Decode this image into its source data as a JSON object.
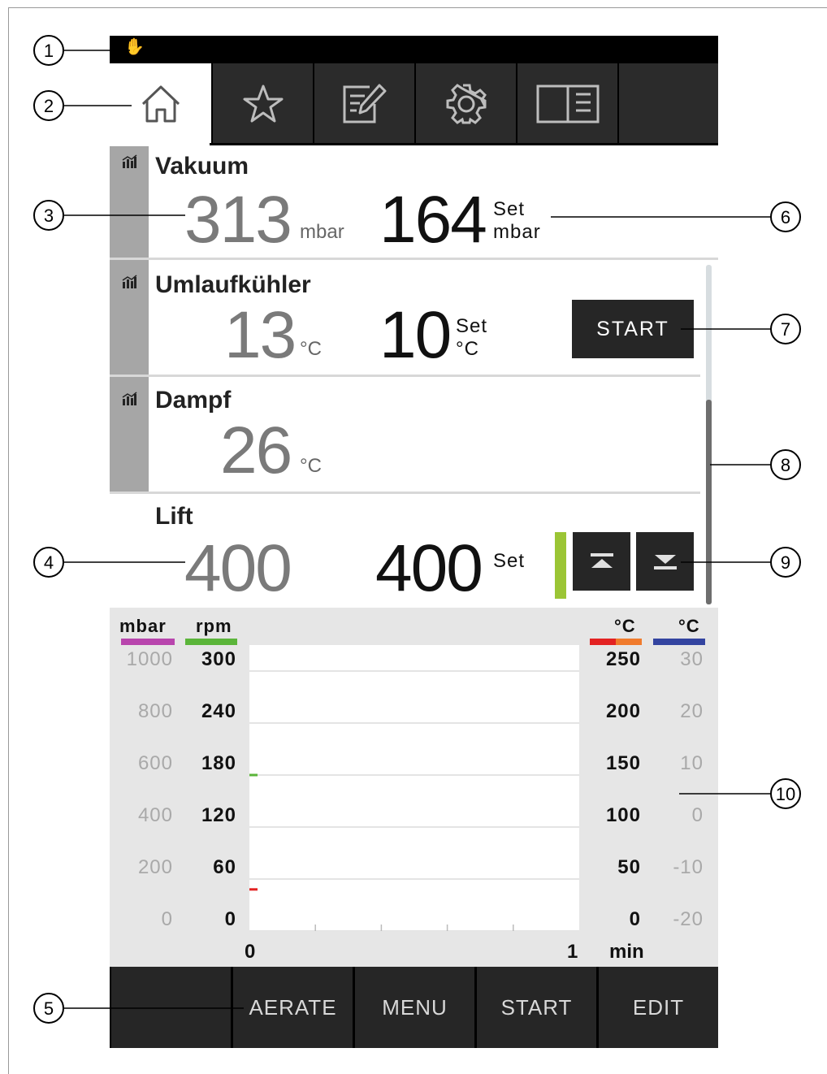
{
  "callouts": [
    "1",
    "2",
    "3",
    "4",
    "5",
    "6",
    "7",
    "8",
    "9",
    "10"
  ],
  "status_bar": {
    "hand_glyph": "✋"
  },
  "tabs": [
    {
      "icon": "home-icon",
      "active": true
    },
    {
      "icon": "star-icon",
      "active": false
    },
    {
      "icon": "edit-icon",
      "active": false
    },
    {
      "icon": "gear-icon",
      "active": false
    },
    {
      "icon": "book-icon",
      "active": false
    }
  ],
  "vakuum": {
    "title": "Vakuum",
    "actual": "313",
    "unit": "mbar",
    "set_value": "164",
    "set_label": "Set",
    "set_unit": "mbar"
  },
  "umlauf": {
    "title": "Umlaufkühler",
    "actual": "13",
    "unit": "°C",
    "set_value": "10",
    "set_label": "Set",
    "set_unit": "°C",
    "start_label": "START"
  },
  "dampf": {
    "title": "Dampf",
    "actual": "26",
    "unit": "°C"
  },
  "lift": {
    "title": "Lift",
    "actual": "400",
    "set_value": "400",
    "set_label": "Set",
    "indicator_color": "#9bc535"
  },
  "chart_data": {
    "type": "line",
    "axes": [
      {
        "side": "left",
        "unit": "mbar",
        "color": "#b845ad",
        "ticks": [
          "1000",
          "800",
          "600",
          "400",
          "200",
          "0"
        ]
      },
      {
        "side": "left",
        "unit": "rpm",
        "color": "#5bb53a",
        "ticks": [
          "300",
          "240",
          "180",
          "120",
          "60",
          "0"
        ]
      },
      {
        "side": "right",
        "unit": "°C",
        "colors": [
          "#e32222",
          "#f07b2d"
        ],
        "ticks": [
          "250",
          "200",
          "150",
          "100",
          "50",
          "0"
        ]
      },
      {
        "side": "right",
        "unit": "°C",
        "color": "#3344a0",
        "ticks": [
          "30",
          "20",
          "10",
          "0",
          "-10",
          "-20"
        ]
      }
    ],
    "x_ticks": [
      "0",
      "1"
    ],
    "x_unit": "min",
    "series": [
      {
        "axis": "rpm",
        "color": "#5bb53a",
        "x": [
          0
        ],
        "y": [
          180
        ]
      },
      {
        "axis": "°C",
        "color": "#e32222",
        "x": [
          0
        ],
        "y": [
          40
        ]
      }
    ]
  },
  "bottom_buttons": [
    "",
    "AERATE",
    "MENU",
    "START",
    "EDIT"
  ]
}
